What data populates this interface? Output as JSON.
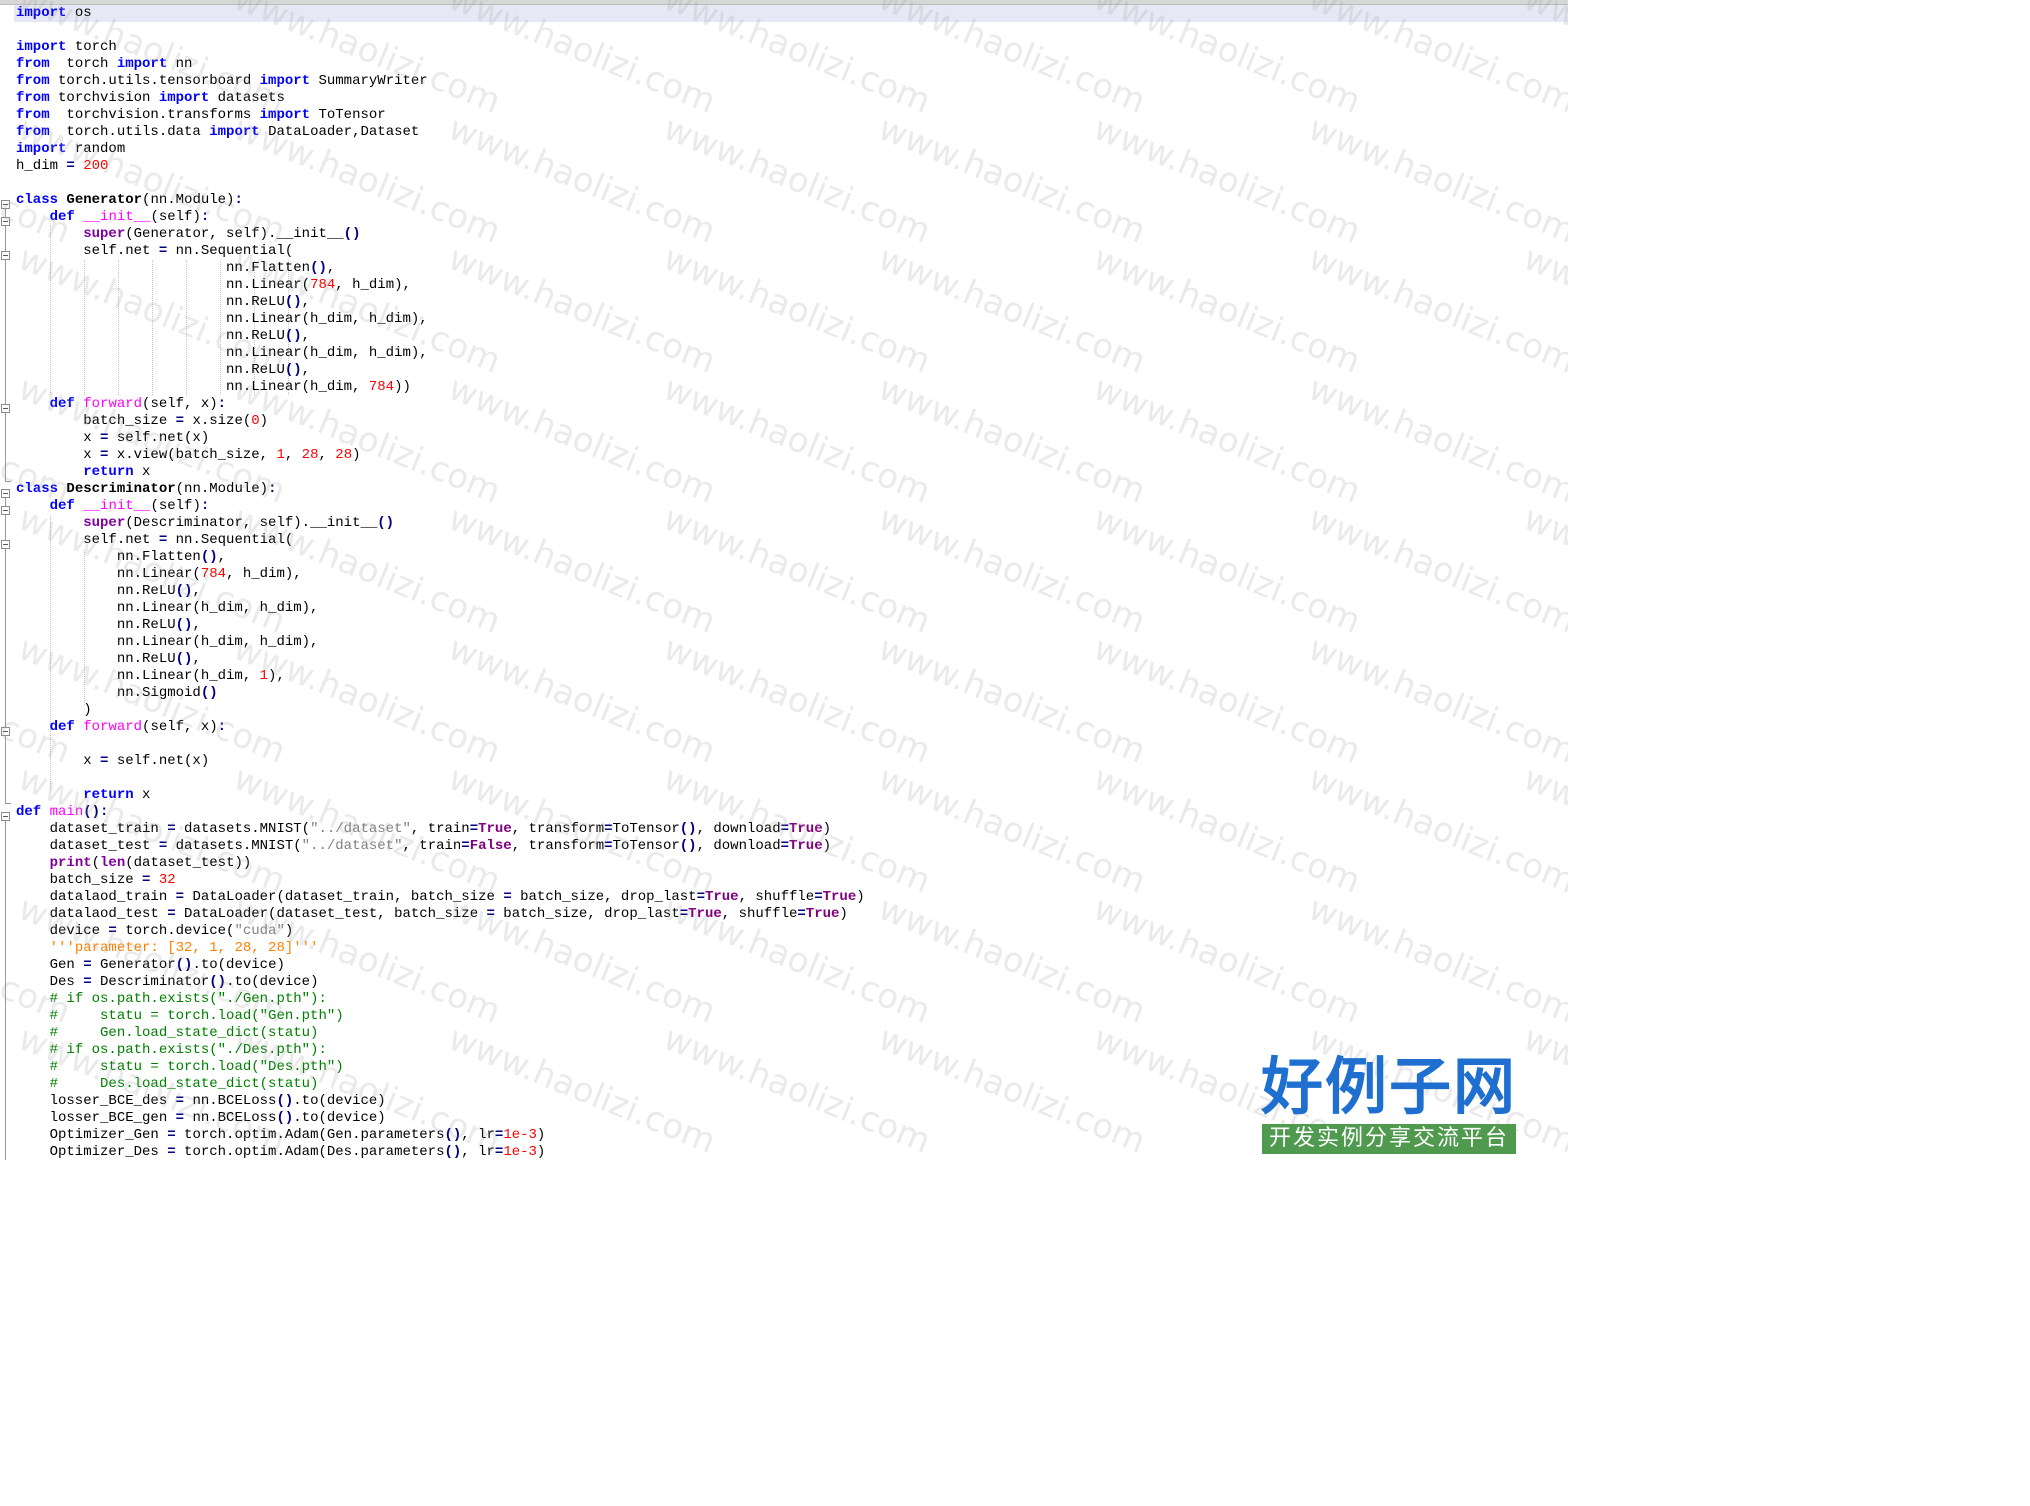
{
  "lines": [
    [
      {
        "t": "import",
        "c": "kw"
      },
      {
        "t": " os"
      }
    ],
    [],
    [
      {
        "t": "import",
        "c": "kw"
      },
      {
        "t": " torch"
      }
    ],
    [
      {
        "t": "from",
        "c": "kw"
      },
      {
        "t": "  torch "
      },
      {
        "t": "import",
        "c": "kw"
      },
      {
        "t": " nn"
      }
    ],
    [
      {
        "t": "from",
        "c": "kw"
      },
      {
        "t": " torch.utils.tensorboard "
      },
      {
        "t": "import",
        "c": "kw"
      },
      {
        "t": " SummaryWriter"
      }
    ],
    [
      {
        "t": "from",
        "c": "kw"
      },
      {
        "t": " torchvision "
      },
      {
        "t": "import",
        "c": "kw"
      },
      {
        "t": " datasets"
      }
    ],
    [
      {
        "t": "from",
        "c": "kw"
      },
      {
        "t": "  torchvision.transforms "
      },
      {
        "t": "import",
        "c": "kw"
      },
      {
        "t": " ToTensor"
      }
    ],
    [
      {
        "t": "from",
        "c": "kw"
      },
      {
        "t": "  torch.utils.data "
      },
      {
        "t": "import",
        "c": "kw"
      },
      {
        "t": " DataLoader,Dataset"
      }
    ],
    [
      {
        "t": "import",
        "c": "kw"
      },
      {
        "t": " random"
      }
    ],
    [
      {
        "t": "h_dim "
      },
      {
        "t": "=",
        "c": "op"
      },
      {
        "t": " "
      },
      {
        "t": "200",
        "c": "num"
      }
    ],
    [],
    [
      {
        "t": "class",
        "c": "kw"
      },
      {
        "t": " "
      },
      {
        "t": "Generator",
        "c": "cls"
      },
      {
        "t": "(nn.Module)"
      },
      {
        "t": ":",
        "c": "op"
      }
    ],
    [
      {
        "t": "    "
      },
      {
        "t": "def",
        "c": "kw"
      },
      {
        "t": " "
      },
      {
        "t": "__init__",
        "c": "fn"
      },
      {
        "t": "(self)"
      },
      {
        "t": ":",
        "c": "op"
      }
    ],
    [
      {
        "t": "        "
      },
      {
        "t": "super",
        "c": "kw2"
      },
      {
        "t": "(Generator, self).__init__"
      },
      {
        "t": "()",
        "c": "op"
      }
    ],
    [
      {
        "t": "        self.net "
      },
      {
        "t": "=",
        "c": "op"
      },
      {
        "t": " nn.Sequential("
      }
    ],
    [
      {
        "t": "                         nn.Flatten"
      },
      {
        "t": "()",
        "c": "op"
      },
      {
        "t": ","
      }
    ],
    [
      {
        "t": "                         nn.Linear("
      },
      {
        "t": "784",
        "c": "num"
      },
      {
        "t": ", h_dim),"
      }
    ],
    [
      {
        "t": "                         nn.ReLU"
      },
      {
        "t": "()",
        "c": "op"
      },
      {
        "t": ","
      }
    ],
    [
      {
        "t": "                         nn.Linear(h_dim, h_dim),"
      }
    ],
    [
      {
        "t": "                         nn.ReLU"
      },
      {
        "t": "()",
        "c": "op"
      },
      {
        "t": ","
      }
    ],
    [
      {
        "t": "                         nn.Linear(h_dim, h_dim),"
      }
    ],
    [
      {
        "t": "                         nn.ReLU"
      },
      {
        "t": "()",
        "c": "op"
      },
      {
        "t": ","
      }
    ],
    [
      {
        "t": "                         nn.Linear(h_dim, "
      },
      {
        "t": "784",
        "c": "num"
      },
      {
        "t": "))"
      }
    ],
    [
      {
        "t": "    "
      },
      {
        "t": "def",
        "c": "kw"
      },
      {
        "t": " "
      },
      {
        "t": "forward",
        "c": "fn"
      },
      {
        "t": "(self, x)"
      },
      {
        "t": ":",
        "c": "op"
      }
    ],
    [
      {
        "t": "        batch_size "
      },
      {
        "t": "=",
        "c": "op"
      },
      {
        "t": " x.size("
      },
      {
        "t": "0",
        "c": "num"
      },
      {
        "t": ")"
      }
    ],
    [
      {
        "t": "        x "
      },
      {
        "t": "=",
        "c": "op"
      },
      {
        "t": " self.net(x)"
      }
    ],
    [
      {
        "t": "        x "
      },
      {
        "t": "=",
        "c": "op"
      },
      {
        "t": " x.view(batch_size, "
      },
      {
        "t": "1",
        "c": "num"
      },
      {
        "t": ", "
      },
      {
        "t": "28",
        "c": "num"
      },
      {
        "t": ", "
      },
      {
        "t": "28",
        "c": "num"
      },
      {
        "t": ")"
      }
    ],
    [
      {
        "t": "        "
      },
      {
        "t": "return",
        "c": "kw"
      },
      {
        "t": " x"
      }
    ],
    [
      {
        "t": "class",
        "c": "kw"
      },
      {
        "t": " "
      },
      {
        "t": "Descriminator",
        "c": "cls"
      },
      {
        "t": "(nn.Module)"
      },
      {
        "t": ":",
        "c": "op"
      }
    ],
    [
      {
        "t": "    "
      },
      {
        "t": "def",
        "c": "kw"
      },
      {
        "t": " "
      },
      {
        "t": "__init__",
        "c": "fn"
      },
      {
        "t": "(self)"
      },
      {
        "t": ":",
        "c": "op"
      }
    ],
    [
      {
        "t": "        "
      },
      {
        "t": "super",
        "c": "kw2"
      },
      {
        "t": "(Descriminator, self).__init__"
      },
      {
        "t": "()",
        "c": "op"
      }
    ],
    [
      {
        "t": "        self.net "
      },
      {
        "t": "=",
        "c": "op"
      },
      {
        "t": " nn.Sequential("
      }
    ],
    [
      {
        "t": "            nn.Flatten"
      },
      {
        "t": "()",
        "c": "op"
      },
      {
        "t": ","
      }
    ],
    [
      {
        "t": "            nn.Linear("
      },
      {
        "t": "784",
        "c": "num"
      },
      {
        "t": ", h_dim),"
      }
    ],
    [
      {
        "t": "            nn.ReLU"
      },
      {
        "t": "()",
        "c": "op"
      },
      {
        "t": ","
      }
    ],
    [
      {
        "t": "            nn.Linear(h_dim, h_dim),"
      }
    ],
    [
      {
        "t": "            nn.ReLU"
      },
      {
        "t": "()",
        "c": "op"
      },
      {
        "t": ","
      }
    ],
    [
      {
        "t": "            nn.Linear(h_dim, h_dim),"
      }
    ],
    [
      {
        "t": "            nn.ReLU"
      },
      {
        "t": "()",
        "c": "op"
      },
      {
        "t": ","
      }
    ],
    [
      {
        "t": "            nn.Linear(h_dim, "
      },
      {
        "t": "1",
        "c": "num"
      },
      {
        "t": "),"
      }
    ],
    [
      {
        "t": "            nn.Sigmoid"
      },
      {
        "t": "()",
        "c": "op"
      }
    ],
    [
      {
        "t": "        )"
      }
    ],
    [
      {
        "t": "    "
      },
      {
        "t": "def",
        "c": "kw"
      },
      {
        "t": " "
      },
      {
        "t": "forward",
        "c": "fn"
      },
      {
        "t": "(self, x)"
      },
      {
        "t": ":",
        "c": "op"
      }
    ],
    [],
    [
      {
        "t": "        x "
      },
      {
        "t": "=",
        "c": "op"
      },
      {
        "t": " self.net(x)"
      }
    ],
    [],
    [
      {
        "t": "        "
      },
      {
        "t": "return",
        "c": "kw"
      },
      {
        "t": " x"
      }
    ],
    [
      {
        "t": "def",
        "c": "kw"
      },
      {
        "t": " "
      },
      {
        "t": "main",
        "c": "fn"
      },
      {
        "t": "()",
        "c": "op"
      },
      {
        "t": ":",
        "c": "op"
      }
    ],
    [
      {
        "t": "    dataset_train "
      },
      {
        "t": "=",
        "c": "op"
      },
      {
        "t": " datasets.MNIST("
      },
      {
        "t": "\"../dataset\"",
        "c": "str"
      },
      {
        "t": ", train"
      },
      {
        "t": "=",
        "c": "op"
      },
      {
        "t": "True",
        "c": "bool"
      },
      {
        "t": ", transform"
      },
      {
        "t": "=",
        "c": "op"
      },
      {
        "t": "ToTensor"
      },
      {
        "t": "()",
        "c": "op"
      },
      {
        "t": ", download"
      },
      {
        "t": "=",
        "c": "op"
      },
      {
        "t": "True",
        "c": "bool"
      },
      {
        "t": ")"
      }
    ],
    [
      {
        "t": "    dataset_test "
      },
      {
        "t": "=",
        "c": "op"
      },
      {
        "t": " datasets.MNIST("
      },
      {
        "t": "\"../dataset\"",
        "c": "str"
      },
      {
        "t": ", train"
      },
      {
        "t": "=",
        "c": "op"
      },
      {
        "t": "False",
        "c": "bool"
      },
      {
        "t": ", transform"
      },
      {
        "t": "=",
        "c": "op"
      },
      {
        "t": "ToTensor"
      },
      {
        "t": "()",
        "c": "op"
      },
      {
        "t": ", download"
      },
      {
        "t": "=",
        "c": "op"
      },
      {
        "t": "True",
        "c": "bool"
      },
      {
        "t": ")"
      }
    ],
    [
      {
        "t": "    "
      },
      {
        "t": "print",
        "c": "kw2"
      },
      {
        "t": "("
      },
      {
        "t": "len",
        "c": "kw2"
      },
      {
        "t": "(dataset_test))"
      }
    ],
    [
      {
        "t": "    batch_size "
      },
      {
        "t": "=",
        "c": "op"
      },
      {
        "t": " "
      },
      {
        "t": "32",
        "c": "num"
      }
    ],
    [
      {
        "t": "    datalaod_train "
      },
      {
        "t": "=",
        "c": "op"
      },
      {
        "t": " DataLoader(dataset_train, batch_size "
      },
      {
        "t": "=",
        "c": "op"
      },
      {
        "t": " batch_size, drop_last"
      },
      {
        "t": "=",
        "c": "op"
      },
      {
        "t": "True",
        "c": "bool"
      },
      {
        "t": ", shuffle"
      },
      {
        "t": "=",
        "c": "op"
      },
      {
        "t": "True",
        "c": "bool"
      },
      {
        "t": ")"
      }
    ],
    [
      {
        "t": "    datalaod_test "
      },
      {
        "t": "=",
        "c": "op"
      },
      {
        "t": " DataLoader(dataset_test, batch_size "
      },
      {
        "t": "=",
        "c": "op"
      },
      {
        "t": " batch_size, drop_last"
      },
      {
        "t": "=",
        "c": "op"
      },
      {
        "t": "True",
        "c": "bool"
      },
      {
        "t": ", shuffle"
      },
      {
        "t": "=",
        "c": "op"
      },
      {
        "t": "True",
        "c": "bool"
      },
      {
        "t": ")"
      }
    ],
    [
      {
        "t": "    device "
      },
      {
        "t": "=",
        "c": "op"
      },
      {
        "t": " torch.device("
      },
      {
        "t": "\"cuda\"",
        "c": "str"
      },
      {
        "t": ")"
      }
    ],
    [
      {
        "t": "    "
      },
      {
        "t": "'''parameter: [32, 1, 28, 28]'''",
        "c": "doc"
      }
    ],
    [
      {
        "t": "    Gen "
      },
      {
        "t": "=",
        "c": "op"
      },
      {
        "t": " Generator"
      },
      {
        "t": "()",
        "c": "op"
      },
      {
        "t": ".to(device)"
      }
    ],
    [
      {
        "t": "    Des "
      },
      {
        "t": "=",
        "c": "op"
      },
      {
        "t": " Descriminator"
      },
      {
        "t": "()",
        "c": "op"
      },
      {
        "t": ".to(device)"
      }
    ],
    [
      {
        "t": "    "
      },
      {
        "t": "# if os.path.exists(\"./Gen.pth\"):",
        "c": "cmt"
      }
    ],
    [
      {
        "t": "    "
      },
      {
        "t": "#     statu = torch.load(\"Gen.pth\")",
        "c": "cmt"
      }
    ],
    [
      {
        "t": "    "
      },
      {
        "t": "#     Gen.load_state_dict(statu)",
        "c": "cmt"
      }
    ],
    [
      {
        "t": "    "
      },
      {
        "t": "# if os.path.exists(\"./Des.pth\"):",
        "c": "cmt"
      }
    ],
    [
      {
        "t": "    "
      },
      {
        "t": "#     statu = torch.load(\"Des.pth\")",
        "c": "cmt"
      }
    ],
    [
      {
        "t": "    "
      },
      {
        "t": "#     Des.load_state_dict(statu)",
        "c": "cmt"
      }
    ],
    [
      {
        "t": "    losser_BCE_des "
      },
      {
        "t": "=",
        "c": "op"
      },
      {
        "t": " nn.BCELoss"
      },
      {
        "t": "()",
        "c": "op"
      },
      {
        "t": ".to(device)"
      }
    ],
    [
      {
        "t": "    losser_BCE_gen "
      },
      {
        "t": "=",
        "c": "op"
      },
      {
        "t": " nn.BCELoss"
      },
      {
        "t": "()",
        "c": "op"
      },
      {
        "t": ".to(device)"
      }
    ],
    [
      {
        "t": "    Optimizer_Gen "
      },
      {
        "t": "=",
        "c": "op"
      },
      {
        "t": " torch.optim.Adam(Gen.parameters"
      },
      {
        "t": "()",
        "c": "op"
      },
      {
        "t": ", lr"
      },
      {
        "t": "=",
        "c": "op"
      },
      {
        "t": "1e-3",
        "c": "num"
      },
      {
        "t": ")"
      }
    ],
    [
      {
        "t": "    Optimizer_Des "
      },
      {
        "t": "=",
        "c": "op"
      },
      {
        "t": " torch.optim.Adam(Des.parameters"
      },
      {
        "t": "()",
        "c": "op"
      },
      {
        "t": ", lr"
      },
      {
        "t": "=",
        "c": "op"
      },
      {
        "t": "1e-3",
        "c": "num"
      },
      {
        "t": ")"
      }
    ]
  ],
  "watermark": {
    "text": "www.haolizi.com",
    "logo_title": "好例子网",
    "logo_subtitle": "开发实例分享交流平台"
  },
  "colors": {
    "keyword": "#0000ff",
    "builtin": "#8000a0",
    "function": "#ff00ff",
    "number": "#ff0000",
    "string": "#808080",
    "docstring": "#ff8000",
    "comment": "#008000",
    "boolean": "#800080",
    "current_line": "#e6e9f5"
  }
}
